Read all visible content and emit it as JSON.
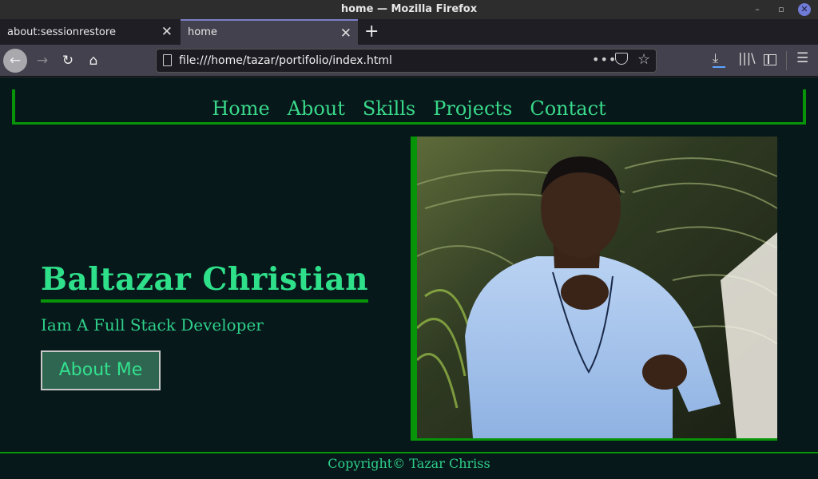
{
  "window": {
    "title": "home — Mozilla Firefox"
  },
  "tabs": [
    {
      "label": "about:sessionrestore"
    },
    {
      "label": "home"
    }
  ],
  "navbar": {
    "url": "file:///home/tazar/portifolio/index.html"
  },
  "site": {
    "nav": [
      "Home",
      "About",
      "Skills",
      "Projects",
      "Contact"
    ],
    "hero": {
      "name": "Baltazar Christian",
      "subtitle": "Iam A Full Stack Developer",
      "button_label": "About Me"
    },
    "footer": "Copyright© Tazar Chriss"
  },
  "colors": {
    "accent_green": "#089408",
    "text_green": "#2fe08a",
    "page_background": "#06181a"
  }
}
